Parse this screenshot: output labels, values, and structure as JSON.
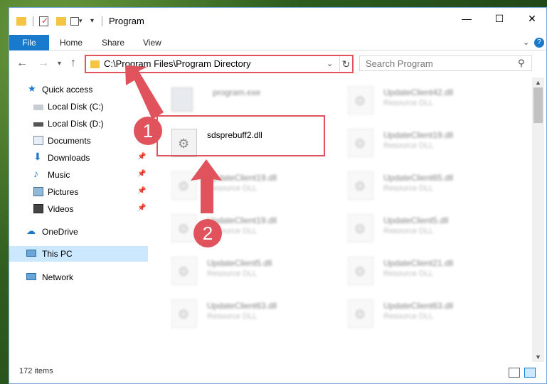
{
  "window": {
    "title": "Program",
    "minimize": "—",
    "maximize": "☐",
    "close": "✕"
  },
  "ribbon": {
    "tabs": [
      "File",
      "Home",
      "Share",
      "View"
    ]
  },
  "address_bar": {
    "path": "C:\\Program Files\\Program Directory"
  },
  "search": {
    "placeholder": "Search Program"
  },
  "sidebar": {
    "items": [
      {
        "label": "Quick access",
        "icon": "star-icon"
      },
      {
        "label": "Local Disk (C:)",
        "icon": "drive-icon"
      },
      {
        "label": "Local Disk (D:)",
        "icon": "drive-icon"
      },
      {
        "label": "Documents",
        "icon": "documents-icon"
      },
      {
        "label": "Downloads",
        "icon": "download-icon"
      },
      {
        "label": "Music",
        "icon": "music-icon"
      },
      {
        "label": "Pictures",
        "icon": "pictures-icon"
      },
      {
        "label": "Videos",
        "icon": "videos-icon"
      },
      {
        "label": "OneDrive",
        "icon": "cloud-icon"
      },
      {
        "label": "This PC",
        "icon": "pc-icon"
      },
      {
        "label": "Network",
        "icon": "network-icon"
      }
    ],
    "selected": "This PC"
  },
  "files": [
    {
      "name": "program.exe",
      "type": ""
    },
    {
      "name": "sdsprebuff2.dll",
      "type": ""
    },
    {
      "name": "UpdateClient19.dll",
      "type": "Resource DLL"
    },
    {
      "name": "UpdateClient19.dll",
      "type": "Resource DLL"
    },
    {
      "name": "UpdateClient5.dll",
      "type": "Resource DLL"
    },
    {
      "name": "UpdateClient63.dll",
      "type": "Resource DLL"
    },
    {
      "name": "UpdateClient42.dll",
      "type": "Resource DLL"
    },
    {
      "name": "UpdateClient19.dll",
      "type": "Resource DLL"
    },
    {
      "name": "UpdateClient65.dll",
      "type": "Resource DLL"
    },
    {
      "name": "UpdateClient5.dll",
      "type": "Resource DLL"
    },
    {
      "name": "UpdateClient21.dll",
      "type": "Resource DLL"
    },
    {
      "name": "UpdateClient63.dll",
      "type": "Resource DLL"
    }
  ],
  "status": {
    "item_count": "172 items"
  },
  "annotations": {
    "badge1": "1",
    "badge2": "2",
    "color": "#e0525c"
  }
}
